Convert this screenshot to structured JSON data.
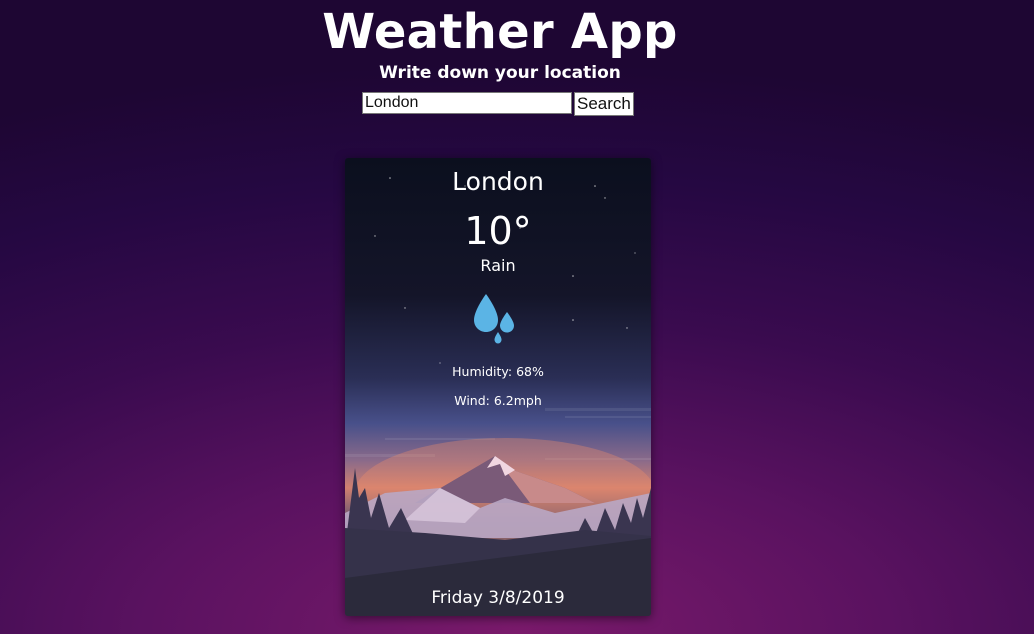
{
  "header": {
    "title": "Weather App",
    "subtitle": "Write down your location"
  },
  "search": {
    "value": "London",
    "button_label": "Search"
  },
  "weather_card": {
    "city": "London",
    "temperature": "10°",
    "condition": "Rain",
    "humidity": "Humidity: 68%",
    "wind": "Wind: 6.2mph",
    "date": "Friday 3/8/2019",
    "icon": "rain-drops-icon"
  },
  "colors": {
    "rain_icon": "#5bb4e5"
  }
}
